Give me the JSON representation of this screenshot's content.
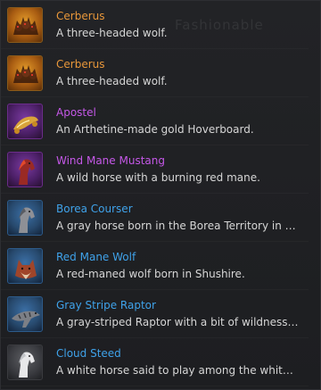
{
  "background_watermark": "Fashionable",
  "items": [
    {
      "name": "Cerberus",
      "description": "A three-headed wolf.",
      "name_color": "#e8973a",
      "icon": "cerberus-icon"
    },
    {
      "name": "Cerberus",
      "description": "A three-headed wolf.",
      "name_color": "#e8973a",
      "icon": "cerberus-icon"
    },
    {
      "name": "Apostel",
      "description": "An Arthetine-made gold Hoverboard.",
      "name_color": "#c558e8",
      "icon": "hoverboard-icon"
    },
    {
      "name": "Wind Mane Mustang",
      "description": "A wild horse with a burning red mane.",
      "name_color": "#c558e8",
      "icon": "red-horse-icon"
    },
    {
      "name": "Borea Courser",
      "description": "A gray horse born in the Borea Territory in East …",
      "name_color": "#3fa2ea",
      "icon": "gray-horse-icon"
    },
    {
      "name": "Red Mane Wolf",
      "description": "A red-maned wolf born in Shushire.",
      "name_color": "#3fa2ea",
      "icon": "red-wolf-icon"
    },
    {
      "name": "Gray Stripe Raptor",
      "description": "A gray-striped Raptor with a bit of wildness still.",
      "name_color": "#3fa2ea",
      "icon": "raptor-icon"
    },
    {
      "name": "Cloud Steed",
      "description": "A white horse said to play among the white clou…",
      "name_color": "#3fa2ea",
      "icon": "white-horse-icon"
    }
  ]
}
